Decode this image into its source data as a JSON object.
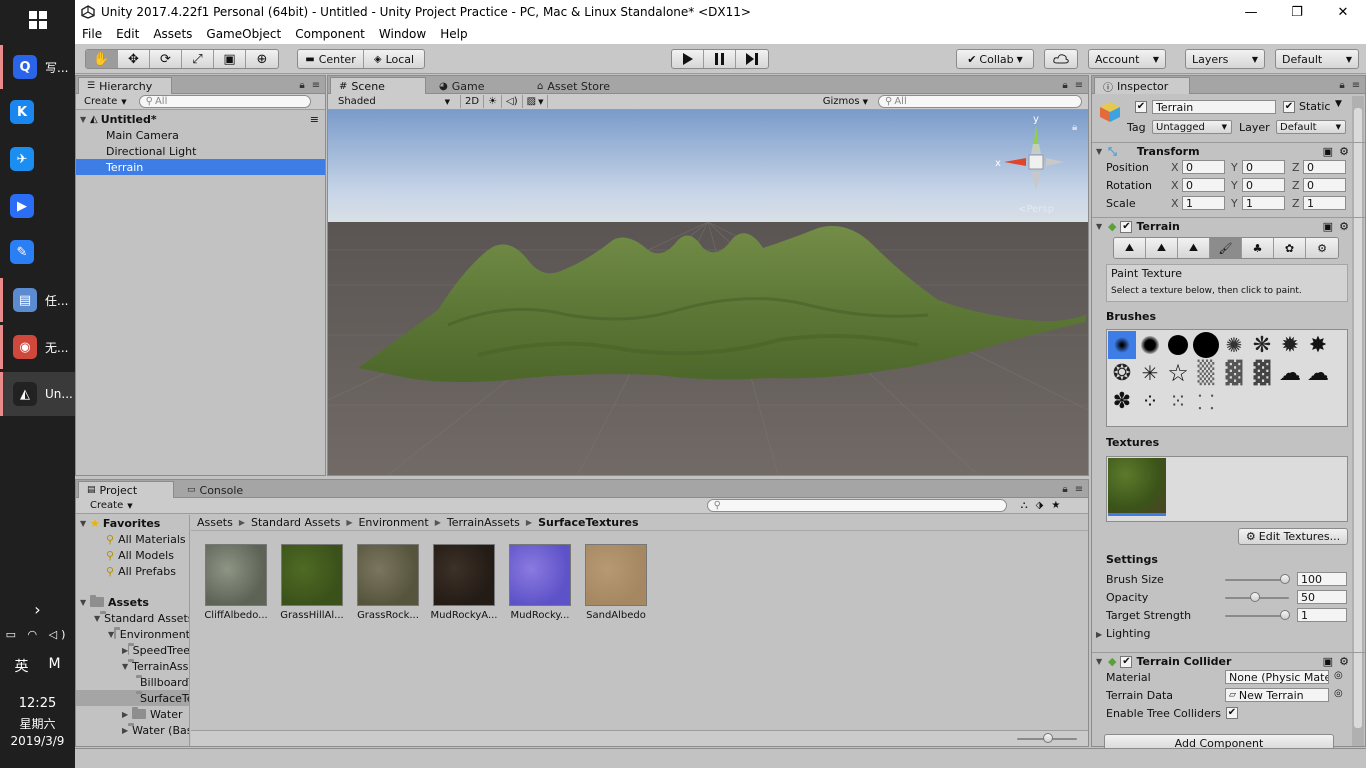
{
  "window": {
    "title": "Unity 2017.4.22f1 Personal (64bit) - Untitled - Unity Project Practice - PC, Mac & Linux Standalone* <DX11>"
  },
  "menu": [
    "File",
    "Edit",
    "Assets",
    "GameObject",
    "Component",
    "Window",
    "Help"
  ],
  "toolbar": {
    "pivot": "Center",
    "space": "Local",
    "collab": "Collab",
    "account": "Account",
    "layers": "Layers",
    "layout": "Default"
  },
  "taskbar": {
    "items": [
      {
        "label": "写...",
        "color": "#2a64e8",
        "glyph": "Q"
      },
      {
        "label": "",
        "color": "#1a87f0",
        "glyph": "K"
      },
      {
        "label": "",
        "color": "#1b8ef2",
        "glyph": "✈"
      },
      {
        "label": "",
        "color": "#2b6ef5",
        "glyph": "▶"
      },
      {
        "label": "",
        "color": "#2b7ff5",
        "glyph": "✎"
      },
      {
        "label": "任...",
        "color": "#5b8bd1",
        "glyph": "▤"
      },
      {
        "label": "无...",
        "color": "#d0473c",
        "glyph": "◉"
      },
      {
        "label": "Un...",
        "color": "#222222",
        "glyph": "◭"
      }
    ],
    "ime_lang": "英",
    "ime_mode": "M",
    "time": "12:25",
    "weekday": "星期六",
    "date": "2019/3/9"
  },
  "hierarchy": {
    "tab": "Hierarchy",
    "create": "Create",
    "search_placeholder": "All",
    "scene": "Untitled*",
    "items": [
      "Main Camera",
      "Directional Light",
      "Terrain"
    ],
    "selected": "Terrain"
  },
  "scene": {
    "tabs": [
      "Scene",
      "Game",
      "Asset Store"
    ],
    "shading": "Shaded",
    "mode_2d": "2D",
    "gizmos": "Gizmos",
    "search_placeholder": "All",
    "gizmo_x": "x",
    "gizmo_y": "y",
    "persp": "<Persp"
  },
  "project": {
    "tabs": [
      "Project",
      "Console"
    ],
    "create": "Create",
    "favorites_label": "Favorites",
    "favorites": [
      "All Materials",
      "All Models",
      "All Prefabs"
    ],
    "assets_label": "Assets",
    "tree": [
      {
        "label": "Standard Assets",
        "depth": 1,
        "open": true
      },
      {
        "label": "Environment",
        "depth": 2,
        "open": true
      },
      {
        "label": "SpeedTree",
        "depth": 3,
        "open": false
      },
      {
        "label": "TerrainAssets",
        "depth": 3,
        "open": true
      },
      {
        "label": "BillboardTextures",
        "depth": 4,
        "open": null
      },
      {
        "label": "SurfaceTextures",
        "depth": 4,
        "open": null,
        "selected": true
      },
      {
        "label": "Water",
        "depth": 3,
        "open": false
      },
      {
        "label": "Water (Basic)",
        "depth": 3,
        "open": false
      }
    ],
    "breadcrumb": [
      "Assets",
      "Standard Assets",
      "Environment",
      "TerrainAssets",
      "SurfaceTextures"
    ],
    "assets": [
      {
        "name": "CliffAlbedo...",
        "color": "#8f9585",
        "accent": "#5d6456"
      },
      {
        "name": "GrassHillAl...",
        "color": "#4f6a24",
        "accent": "#3a521a"
      },
      {
        "name": "GrassRock...",
        "color": "#7c7560",
        "accent": "#56553c"
      },
      {
        "name": "MudRockyA...",
        "color": "#3d3128",
        "accent": "#231b15"
      },
      {
        "name": "MudRocky...",
        "color": "#8a7ae0",
        "accent": "#5e52c8"
      },
      {
        "name": "SandAlbedo",
        "color": "#b79a72",
        "accent": "#a58762"
      }
    ]
  },
  "inspector": {
    "tab": "Inspector",
    "object_name": "Terrain",
    "static_label": "Static",
    "tag_label": "Tag",
    "tag_value": "Untagged",
    "layer_label": "Layer",
    "layer_value": "Default",
    "transform": {
      "title": "Transform",
      "rows": [
        {
          "label": "Position",
          "x": "0",
          "y": "0",
          "z": "0"
        },
        {
          "label": "Rotation",
          "x": "0",
          "y": "0",
          "z": "0"
        },
        {
          "label": "Scale",
          "x": "1",
          "y": "1",
          "z": "1"
        }
      ],
      "axis_x": "X",
      "axis_y": "Y",
      "axis_z": "Z"
    },
    "terrain": {
      "title": "Terrain",
      "tool_title": "Paint Texture",
      "tool_hint": "Select a texture below, then click to paint.",
      "brushes_label": "Brushes",
      "textures_label": "Textures",
      "edit_textures": "Edit Textures...",
      "settings_label": "Settings",
      "settings": [
        {
          "label": "Brush Size",
          "value": "100",
          "level": 1.0
        },
        {
          "label": "Opacity",
          "value": "50",
          "level": 0.5
        },
        {
          "label": "Target Strength",
          "value": "1",
          "level": 1.0
        }
      ],
      "lighting_label": "Lighting"
    },
    "collider": {
      "title": "Terrain Collider",
      "material_label": "Material",
      "material_value": "None (Physic Material)",
      "data_label": "Terrain Data",
      "data_value": "New Terrain",
      "tree_label": "Enable Tree Colliders",
      "tree_checked": true
    },
    "add_component": "Add Component"
  },
  "colors": {
    "selection": "#3e7de6",
    "sky_top": "#7f9fcb",
    "sky_bottom": "#ccd9ea",
    "ground": "#6d6663",
    "terrain": "#5f7a36"
  }
}
